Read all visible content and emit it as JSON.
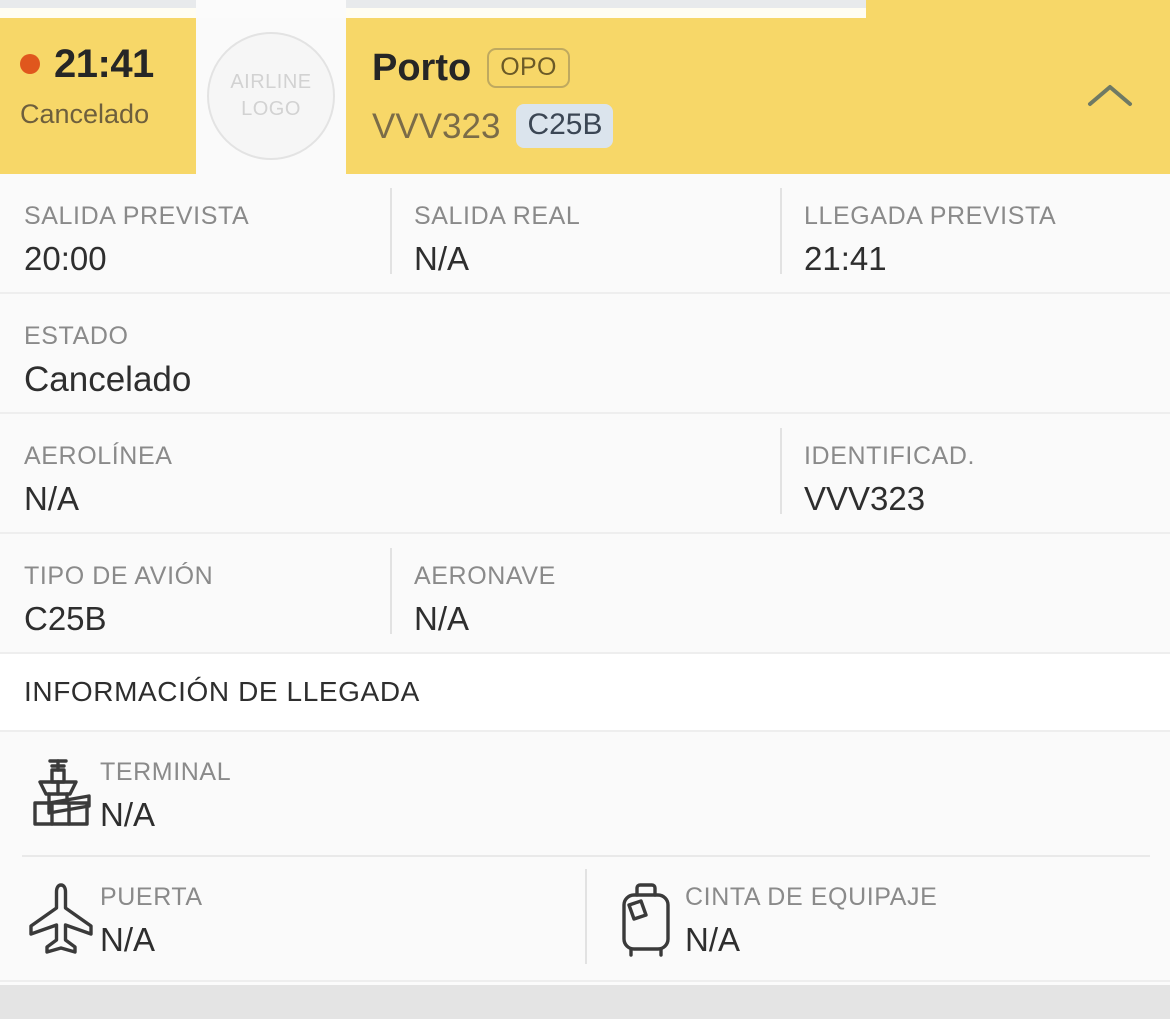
{
  "header": {
    "time": "21:41",
    "status_short": "Cancelado",
    "status_dot_color": "#e0571d",
    "background_color": "#f7d768",
    "logo_placeholder_line1": "AIRLINE",
    "logo_placeholder_line2": "LOGO",
    "city": "Porto",
    "iata": "OPO",
    "flight_ident": "VVV323",
    "aircraft_code": "C25B",
    "toggle_icon": "chevron-up-icon"
  },
  "rows": [
    {
      "fields": [
        {
          "label": "SALIDA PREVISTA",
          "value": "20:00"
        },
        {
          "label": "SALIDA REAL",
          "value": "N/A"
        },
        {
          "label": "LLEGADA PREVISTA",
          "value": "21:41"
        }
      ]
    },
    {
      "fields": [
        {
          "label": "ESTADO",
          "value": "Cancelado"
        }
      ]
    },
    {
      "fields": [
        {
          "label": "AEROLÍNEA",
          "value": "N/A"
        },
        {
          "label": "IDENTIFICAD.",
          "value": "VVV323"
        }
      ]
    },
    {
      "fields": [
        {
          "label": "TIPO DE AVIÓN",
          "value": "C25B"
        },
        {
          "label": "AERONAVE",
          "value": "N/A"
        }
      ]
    }
  ],
  "arrival_section": {
    "title": "INFORMACIÓN DE LLEGADA",
    "terminal": {
      "icon": "control-tower-icon",
      "label": "TERMINAL",
      "value": "N/A"
    },
    "gate": {
      "icon": "airplane-icon",
      "label": "PUERTA",
      "value": "N/A"
    },
    "baggage": {
      "icon": "suitcase-icon",
      "label": "CINTA DE EQUIPAJE",
      "value": "N/A"
    }
  }
}
